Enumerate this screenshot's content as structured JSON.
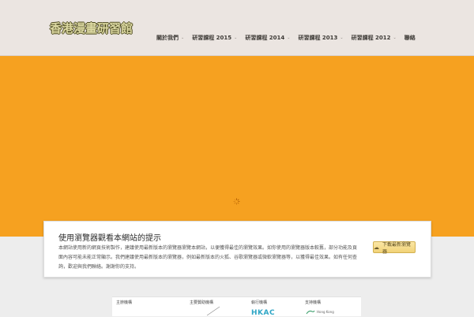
{
  "header": {
    "logo_text": "香港漫畫研習館",
    "nav": [
      {
        "label": "關於我們",
        "has_dropdown": true
      },
      {
        "label": "研習課程 2015",
        "has_dropdown": true
      },
      {
        "label": "研習課程 2014",
        "has_dropdown": true
      },
      {
        "label": "研習課程 2013",
        "has_dropdown": true
      },
      {
        "label": "研習課程 2012",
        "has_dropdown": true
      },
      {
        "label": "聯絡",
        "has_dropdown": false
      }
    ]
  },
  "hero": {
    "background_color": "#f6a120",
    "loading": true
  },
  "notice": {
    "title": "使用瀏覽器觀看本網站的提示",
    "body": "本網站使用新的網頁技術製作，建議使用最新版本的瀏覽器瀏覽本網站，以便獲得最佳的瀏覽效果。如你使用的瀏覽器版本較舊，部分功能及頁面內容可能未能正常顯示。我們建議使用最新版本的瀏覽器，例如最新版本的火狐、谷歌瀏覽器或微軟瀏覽器等，以獲得最佳效果。如有任何查詢，歡迎與我們聯絡。謝謝你的支持。",
    "button_label": "下載最新瀏覽器",
    "button_icon": "cloud-download-icon"
  },
  "sponsors": {
    "columns": [
      "主辦機構",
      "主要贊助機構",
      "執行機構",
      "支持機構"
    ],
    "hkac_text": "HKAC",
    "hk_text": "Hong Kong"
  },
  "colors": {
    "accent": "#f6a120",
    "header_bg": "#ebe5e1",
    "button_bg": "#f1d277"
  }
}
